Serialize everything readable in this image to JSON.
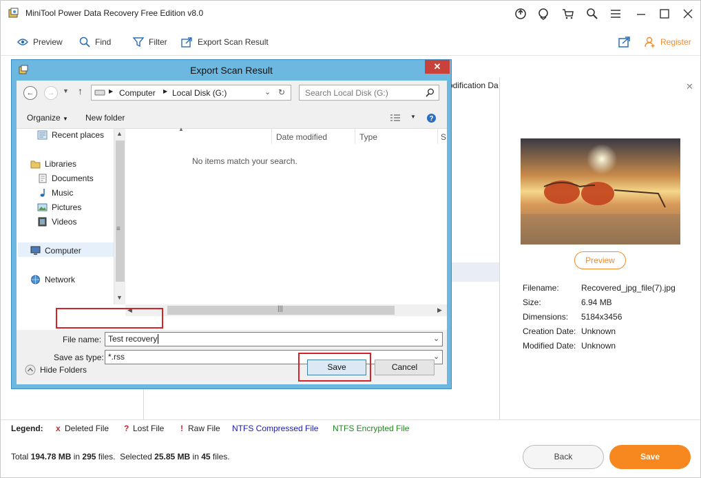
{
  "app": {
    "title": "MiniTool Power Data Recovery Free Edition v8.0"
  },
  "toolbar": {
    "preview": "Preview",
    "find": "Find",
    "filter": "Filter",
    "export": "Export Scan Result",
    "register": "Register"
  },
  "main": {
    "col_modification": "odification Da"
  },
  "preview_panel": {
    "preview_button": "Preview",
    "filename_label": "Filename:",
    "filename_value": "Recovered_jpg_file(7).jpg",
    "size_label": "Size:",
    "size_value": "6.94 MB",
    "dimensions_label": "Dimensions:",
    "dimensions_value": "5184x3456",
    "creation_label": "Creation Date:",
    "creation_value": "Unknown",
    "modified_label": "Modified Date:",
    "modified_value": "Unknown"
  },
  "legend": {
    "label": "Legend:",
    "deleted": "Deleted File",
    "lost": "Lost File",
    "raw": "Raw File",
    "compressed": "NTFS Compressed File",
    "encrypted": "NTFS Encrypted File",
    "deleted_mark": "x",
    "lost_mark": "?",
    "raw_mark": "!",
    "colors": {
      "mark": "#d3232a",
      "compressed": "#1a1ab0",
      "encrypted": "#1e8a1e"
    }
  },
  "footer": {
    "total_prefix": "Total ",
    "total_size": "194.78 MB",
    "in1": " in ",
    "total_files": "295",
    "files1": " files.  Selected ",
    "sel_size": "25.85 MB",
    "in2": " in ",
    "sel_files": "45",
    "files2": " files.",
    "back": "Back",
    "save": "Save"
  },
  "dialog": {
    "title": "Export Scan Result",
    "breadcrumb_computer": "Computer",
    "breadcrumb_disk": "Local Disk (G:)",
    "search_placeholder": "Search Local Disk (G:)",
    "organize": "Organize",
    "new_folder": "New folder",
    "nav": {
      "recent": "Recent places",
      "libraries": "Libraries",
      "documents": "Documents",
      "music": "Music",
      "pictures": "Pictures",
      "videos": "Videos",
      "computer": "Computer",
      "network": "Network"
    },
    "col_date": "Date modified",
    "col_type": "Type",
    "col_size_fragment": "S",
    "empty_msg": "No items match your search.",
    "file_name_label": "File name:",
    "file_name_value": "Test recovery",
    "save_type_label": "Save as type:",
    "save_type_value": "*.rss",
    "hide_folders": "Hide Folders",
    "save": "Save",
    "cancel": "Cancel"
  }
}
